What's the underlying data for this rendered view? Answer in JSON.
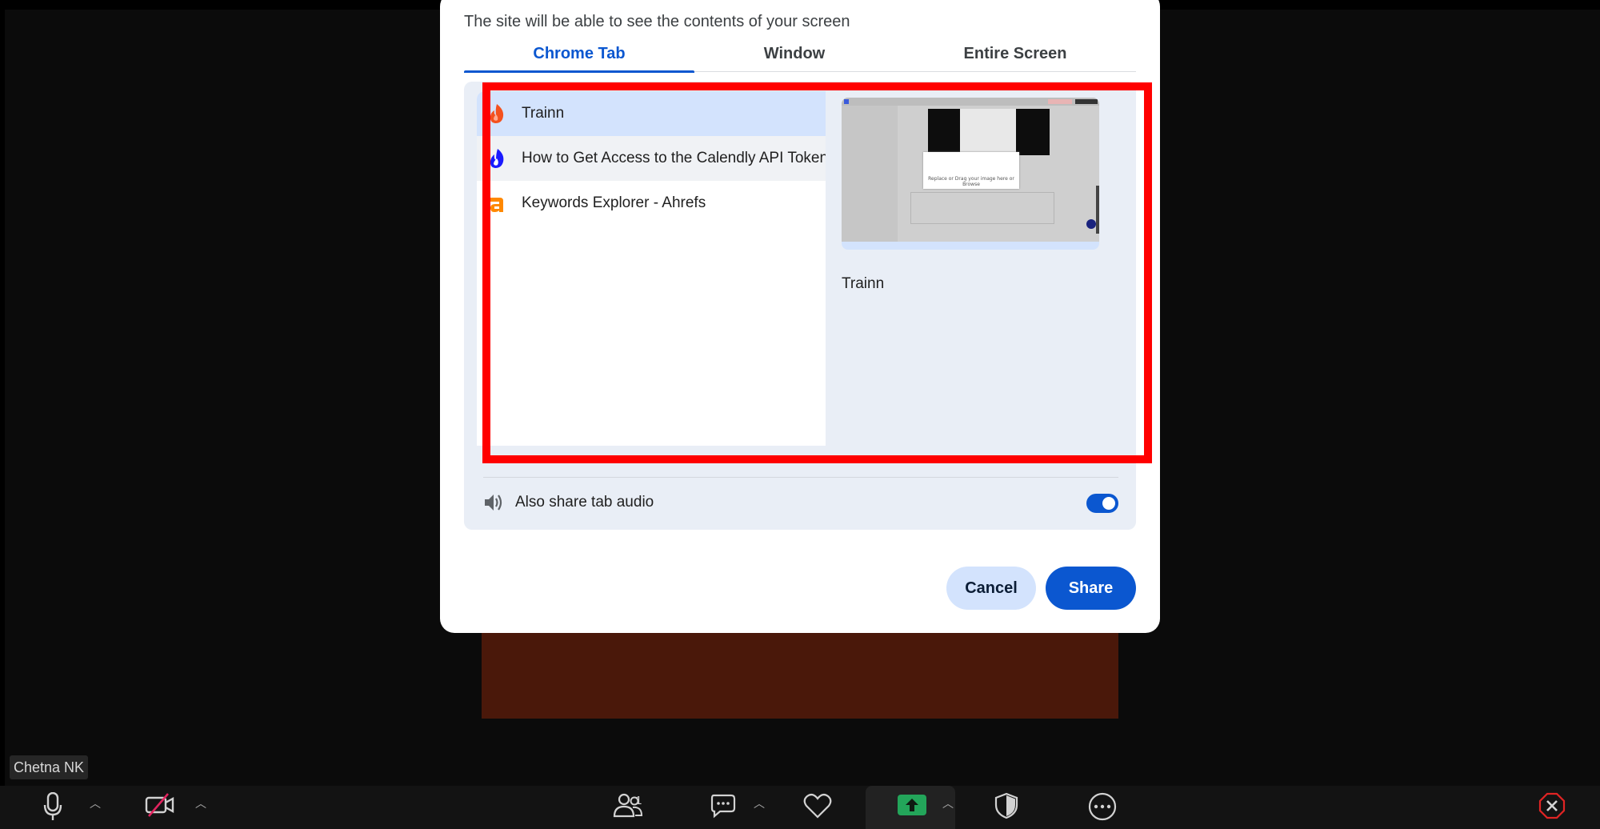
{
  "dialog": {
    "subtitle": "The site will be able to see the contents of your screen",
    "tabs": [
      {
        "label": "Chrome Tab",
        "active": true
      },
      {
        "label": "Window",
        "active": false
      },
      {
        "label": "Entire Screen",
        "active": false
      }
    ],
    "tab_list": [
      {
        "title": "Trainn",
        "icon": "trainn-flame-icon",
        "state": "selected"
      },
      {
        "title": "How to Get Access to the Calendly API Token",
        "icon": "calendly-flame-icon",
        "state": "hover"
      },
      {
        "title": "Keywords Explorer - Ahrefs",
        "icon": "ahrefs-icon",
        "state": "normal"
      }
    ],
    "preview": {
      "title": "Trainn",
      "thumb_caption": "Replace or Drag your image here or Browse"
    },
    "audio": {
      "label": "Also share tab audio",
      "enabled": true
    },
    "buttons": {
      "cancel": "Cancel",
      "share": "Share"
    }
  },
  "meeting": {
    "participant_name": "Chetna NK",
    "toolbar": {
      "participants_count": "1",
      "items": [
        "mic-icon",
        "video-off-icon",
        "participants-icon",
        "chat-icon",
        "reactions-icon",
        "share-screen-icon",
        "security-icon",
        "more-icon",
        "end-icon"
      ]
    }
  },
  "colors": {
    "accent": "#0b57d0",
    "selected_row": "#d3e3fd",
    "annotation_red": "#ff0000",
    "panel_bg": "#e9eef6"
  }
}
